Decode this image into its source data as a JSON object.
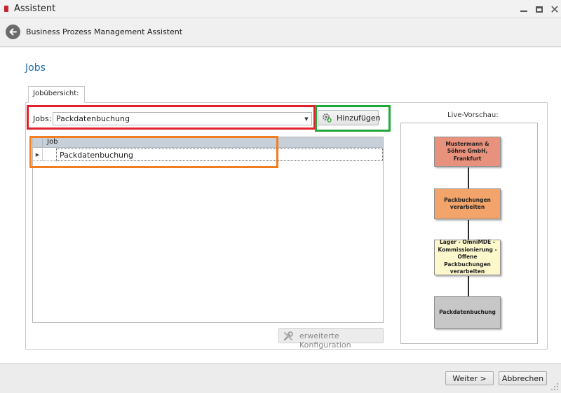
{
  "window": {
    "title": "Assistent",
    "close_glyph": "✕"
  },
  "header": {
    "title": "Business Prozess Management Assistent"
  },
  "page": {
    "title": "Jobs"
  },
  "tab": {
    "label": "Jobübersicht:"
  },
  "jobs_select": {
    "label": "Jobs:",
    "value": "Packdatenbuchung",
    "arrow_glyph": "▼"
  },
  "add_button": {
    "label": "Hinzufügen",
    "icon": "gear-plus-icon"
  },
  "grid": {
    "columns": [
      "Job"
    ],
    "rows": [
      {
        "job": "Packdatenbuchung"
      }
    ],
    "row_indicator_glyph": "▶"
  },
  "ext_config_button": {
    "label": "erweiterte Konfiguration",
    "icon": "tools-icon",
    "enabled": false
  },
  "preview": {
    "title": "Live-Vorschau:",
    "nodes": [
      {
        "label": "Mustermann & Söhne GmbH, Frankfurt",
        "color": "#e8917c"
      },
      {
        "label": "Packbuchungen verarbeiten",
        "color": "#f2a46a"
      },
      {
        "label": "Lager - OmniMDE - Kommissionierung - Offene Packbuchungen verarbeiten",
        "color": "#fdf8cc"
      },
      {
        "label": "Packdatenbuchung",
        "color": "#c7c7c7"
      }
    ]
  },
  "footer": {
    "next_label": "Weiter >",
    "cancel_label": "Abbrechen"
  },
  "highlights": {
    "red": "#e0202a",
    "green": "#22a83a",
    "orange": "#f47c20"
  },
  "theme": {
    "accent": "#1f6fb5"
  }
}
